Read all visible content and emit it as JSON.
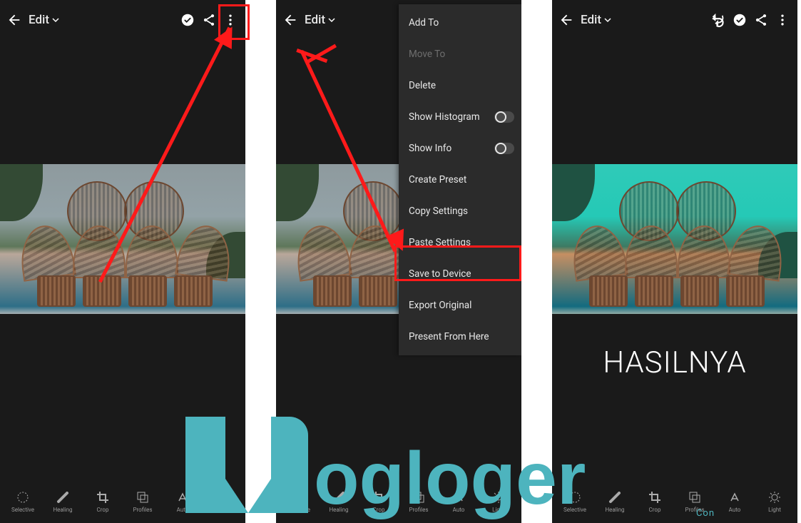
{
  "topbar": {
    "edit": "Edit"
  },
  "tools": [
    "Selective",
    "Healing",
    "Crop",
    "Profiles",
    "Auto",
    "Light"
  ],
  "menu": [
    "Add To",
    "Move To",
    "Delete",
    "Show Histogram",
    "Show Info",
    "Create Preset",
    "Copy Settings",
    "Paste Settings",
    "Save to Device",
    "Export Original",
    "Present From Here"
  ],
  "result_caption": "HASILNYA",
  "watermark": {
    "text": "ogloger",
    "sub": "Con"
  }
}
